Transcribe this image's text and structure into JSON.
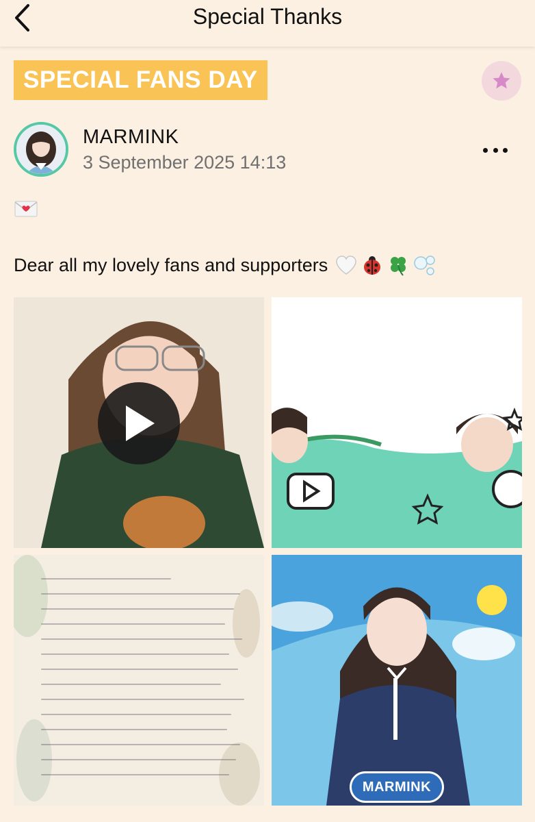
{
  "header": {
    "title": "Special Thanks",
    "back_icon": "chevron-left-icon"
  },
  "banner": {
    "text": "SPECIAL FANS DAY",
    "color": "#f9c356"
  },
  "favorite": {
    "icon": "star-icon",
    "color": "#d68ac8"
  },
  "post": {
    "author": "MARMINK",
    "date": "3 September 2025 14:13",
    "avatar_ring_color": "#56c8a5",
    "more_icon": "more-horizontal-icon",
    "envelope": "💌",
    "text": "Dear all my lovely fans and supporters",
    "emojis": [
      "🤍",
      "🐞",
      "🍀",
      "🫧"
    ]
  },
  "media": {
    "tiles": [
      {
        "kind": "video",
        "icon": "play-icon"
      },
      {
        "kind": "image"
      },
      {
        "kind": "image"
      },
      {
        "kind": "image",
        "badge": "MARMINK"
      }
    ]
  },
  "colors": {
    "background": "#fbf0e2",
    "badge_blue": "#2e6bb8",
    "teal": "#6fd3b8"
  }
}
